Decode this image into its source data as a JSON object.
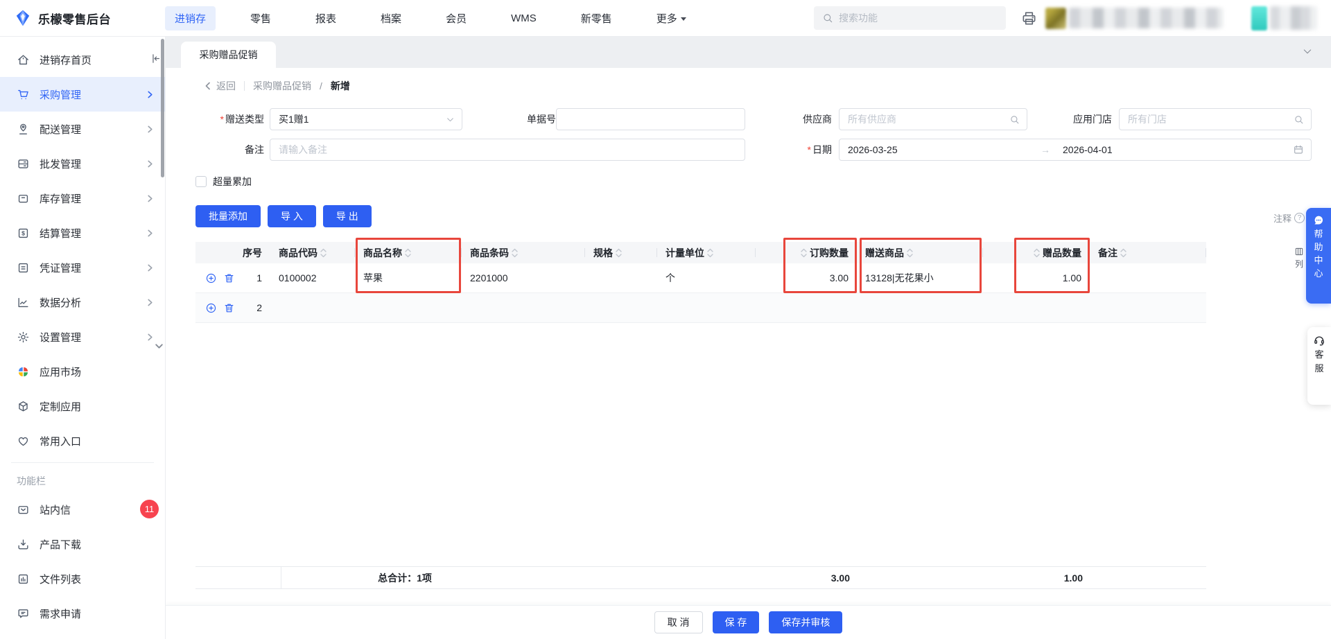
{
  "navbar": {
    "title": "乐檬零售后台",
    "menu": [
      "进销存",
      "零售",
      "报表",
      "档案",
      "会员",
      "WMS",
      "新零售",
      "更多"
    ],
    "search_placeholder": "搜索功能"
  },
  "sidebar": {
    "items": [
      {
        "label": "进销存首页"
      },
      {
        "label": "采购管理"
      },
      {
        "label": "配送管理"
      },
      {
        "label": "批发管理"
      },
      {
        "label": "库存管理"
      },
      {
        "label": "结算管理"
      },
      {
        "label": "凭证管理"
      },
      {
        "label": "数据分析"
      },
      {
        "label": "设置管理"
      },
      {
        "label": "应用市场"
      },
      {
        "label": "定制应用"
      },
      {
        "label": "常用入口"
      }
    ],
    "section_label": "功能栏",
    "bottom_items": [
      {
        "label": "站内信",
        "badge": "11"
      },
      {
        "label": "产品下载"
      },
      {
        "label": "文件列表"
      },
      {
        "label": "需求申请"
      }
    ]
  },
  "tab": {
    "label": "采购赠品促销"
  },
  "breadcrumb": {
    "back": "返回",
    "parent": "采购赠品促销",
    "separator": "/",
    "current": "新增"
  },
  "form": {
    "gift_type_label": "赠送类型",
    "gift_type_value": "买1赠1",
    "order_no_label": "单据号",
    "supplier_label": "供应商",
    "supplier_placeholder": "所有供应商",
    "store_label": "应用门店",
    "store_placeholder": "所有门店",
    "remark_label": "备注",
    "remark_placeholder": "请输入备注",
    "date_label": "日期",
    "date_start": "2026-03-25",
    "date_end": "2026-04-01",
    "over_accumulate_label": "超量累加"
  },
  "toolbar": {
    "batch_add": "批量添加",
    "import": "导 入",
    "export": "导 出",
    "annotation": "注释",
    "column": "列"
  },
  "table": {
    "headers": {
      "seq": "序号",
      "code": "商品代码",
      "name": "商品名称",
      "barcode": "商品条码",
      "spec": "规格",
      "unit": "计量单位",
      "order_qty": "订购数量",
      "gift_item": "赠送商品",
      "gift_qty": "赠品数量",
      "remark": "备注"
    },
    "rows": [
      {
        "seq": "1",
        "code": "0100002",
        "name": "苹果",
        "barcode": "2201000",
        "spec": "",
        "unit": "个",
        "order_qty": "3.00",
        "gift_item": "13128|无花果小",
        "gift_qty": "1.00",
        "remark": ""
      },
      {
        "seq": "2",
        "code": "",
        "name": "",
        "barcode": "",
        "spec": "",
        "unit": "",
        "order_qty": "",
        "gift_item": "",
        "gift_qty": "",
        "remark": ""
      }
    ],
    "footer": {
      "total": "总合计：1项",
      "order_qty": "3.00",
      "gift_qty": "1.00"
    }
  },
  "actions": {
    "cancel": "取 消",
    "save": "保 存",
    "save_audit": "保存并审核"
  },
  "float": {
    "help": [
      "帮",
      "助",
      "中",
      "心"
    ],
    "service": [
      "客",
      "服"
    ]
  }
}
